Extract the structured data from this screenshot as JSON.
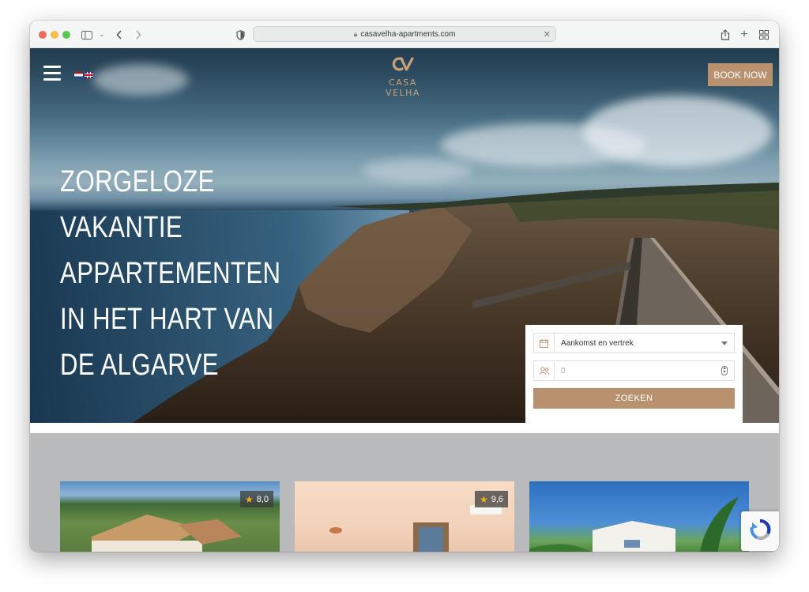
{
  "browser": {
    "url": "casavelha-apartments.com",
    "colors": {
      "close": "#ed6a5e",
      "minimize": "#f5bf4f",
      "zoom": "#61c554"
    }
  },
  "header": {
    "brand": "CASA VELHA",
    "book_button": "BOOK NOW",
    "languages": [
      "nl",
      "en"
    ]
  },
  "hero": {
    "headline": "ZORGELOZE VAKANTIE APPARTEMENTEN IN HET HART VAN DE ALGARVE"
  },
  "booking": {
    "dates_placeholder": "Aankomst en vertrek",
    "guests_value": "0",
    "search_button": "ZOEKEN"
  },
  "cards": [
    {
      "rating": "8,0"
    },
    {
      "rating": "9,6"
    },
    {
      "rating": ""
    }
  ],
  "theme": {
    "accent": "#b8926f"
  }
}
